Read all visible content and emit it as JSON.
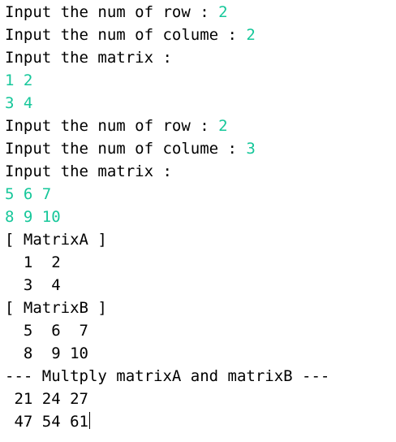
{
  "console": {
    "colors": {
      "background": "#ffffff",
      "output_text": "#000000",
      "user_input_text": "#16c79a"
    },
    "lines": [
      {
        "prompt": "Input the num of row : ",
        "input": "2"
      },
      {
        "prompt": "Input the num of colume : ",
        "input": "2"
      },
      {
        "prompt": "Input the matrix :",
        "input": ""
      },
      {
        "prompt": "",
        "input": "1 2"
      },
      {
        "prompt": "",
        "input": "3 4"
      },
      {
        "prompt": "Input the num of row : ",
        "input": "2"
      },
      {
        "prompt": "Input the num of colume : ",
        "input": "3"
      },
      {
        "prompt": "Input the matrix :",
        "input": ""
      },
      {
        "prompt": "",
        "input": "5 6 7"
      },
      {
        "prompt": "",
        "input": "8 9 10"
      },
      {
        "prompt": "[ MatrixA ]",
        "input": ""
      },
      {
        "prompt": "  1  2",
        "input": ""
      },
      {
        "prompt": "  3  4",
        "input": ""
      },
      {
        "prompt": "[ MatrixB ]",
        "input": ""
      },
      {
        "prompt": "  5  6  7",
        "input": ""
      },
      {
        "prompt": "  8  9 10",
        "input": ""
      },
      {
        "prompt": "--- Multply matrixA and matrixB ---",
        "input": ""
      },
      {
        "prompt": " 21 24 27",
        "input": ""
      },
      {
        "prompt": " 47 54 61",
        "input": ""
      }
    ]
  }
}
